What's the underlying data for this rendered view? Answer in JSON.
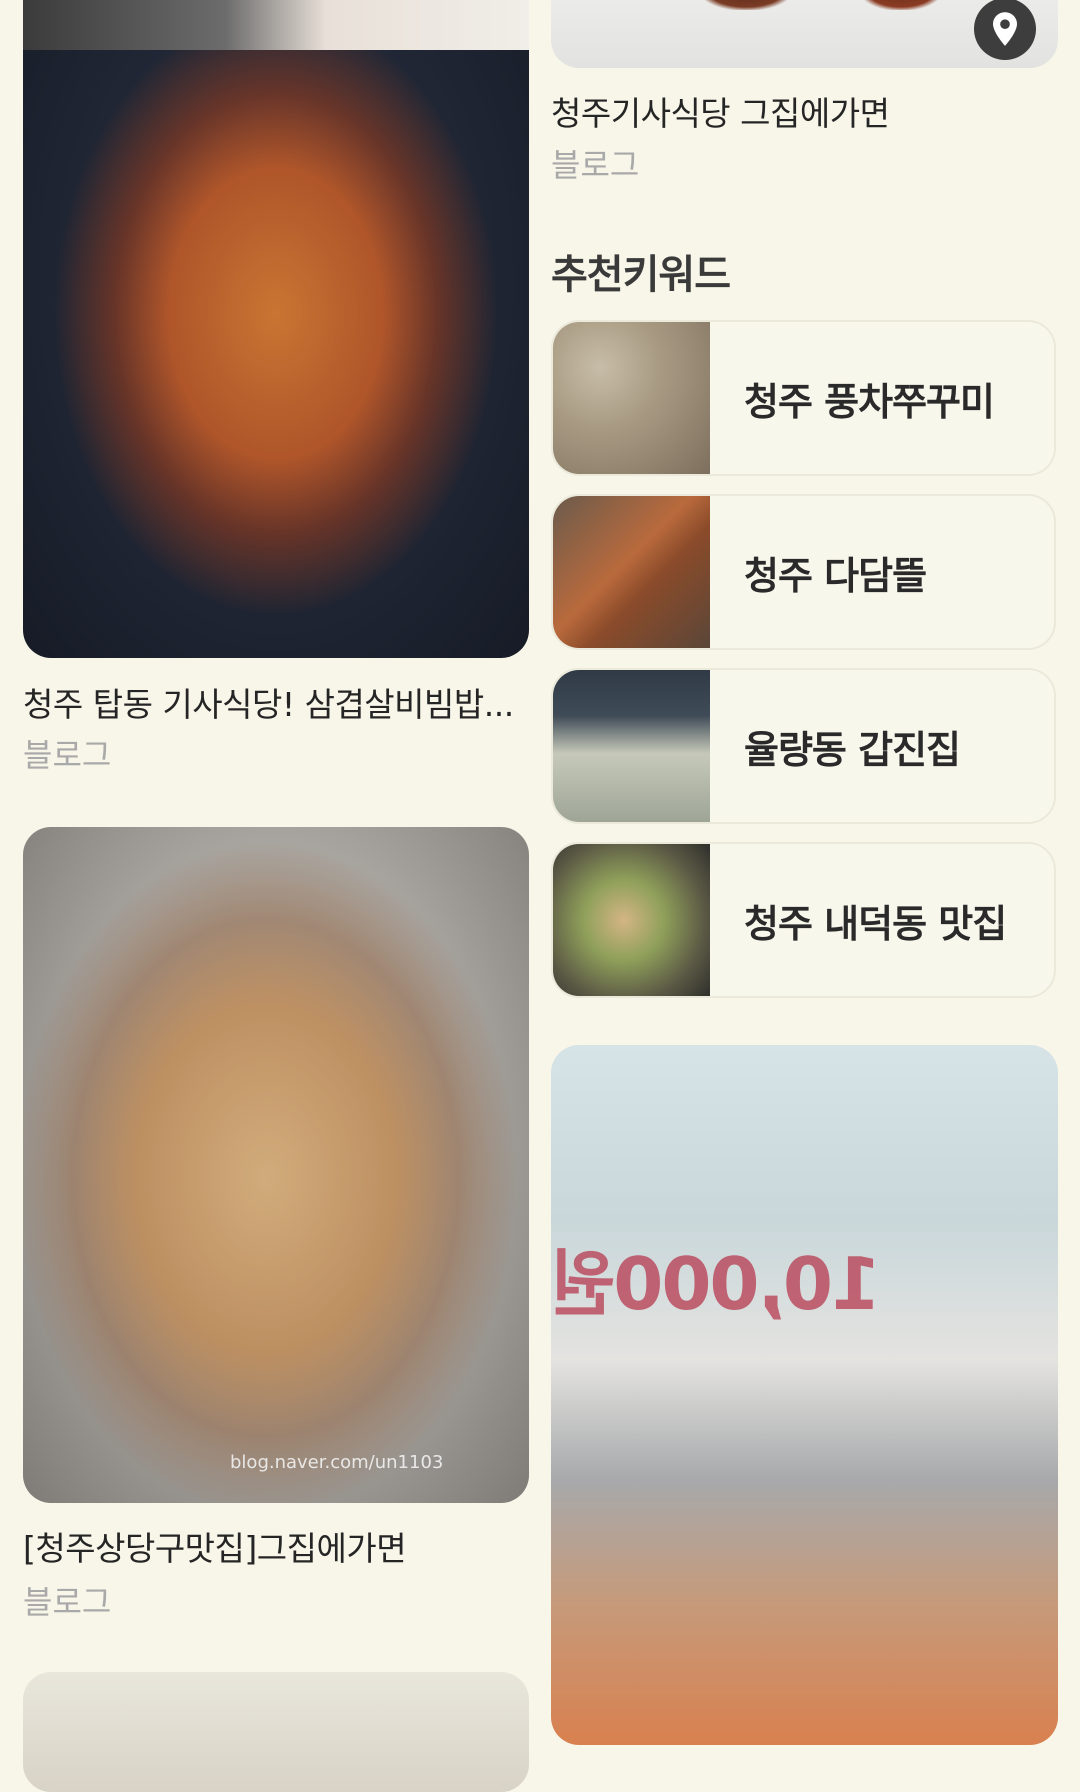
{
  "left_column": {
    "cards": [
      {
        "title": "청주 탑동 기사식당! 삼겹살비빔밥...",
        "source": "블로그"
      },
      {
        "title": "[청주상당구맛집]그집에가면",
        "source": "블로그",
        "image_watermark": "blog.naver.com/un1103"
      }
    ]
  },
  "right_column": {
    "top_card": {
      "title": "청주기사식당 그집에가면",
      "source": "블로그"
    },
    "keywords_section": {
      "title": "추천키워드",
      "items": [
        {
          "label": "청주 풍차쭈꾸미"
        },
        {
          "label": "청주 다담뜰"
        },
        {
          "label": "율량동 갑진집"
        },
        {
          "label": "청주 내덕동 맛집"
        }
      ]
    },
    "buffet_card": {
      "sign_text": "10,000원"
    }
  },
  "colors": {
    "background": "#f7f6e9",
    "muted_text": "#a9a9a9",
    "title_text": "#252525",
    "pin_bg": "#3d3d3d"
  }
}
